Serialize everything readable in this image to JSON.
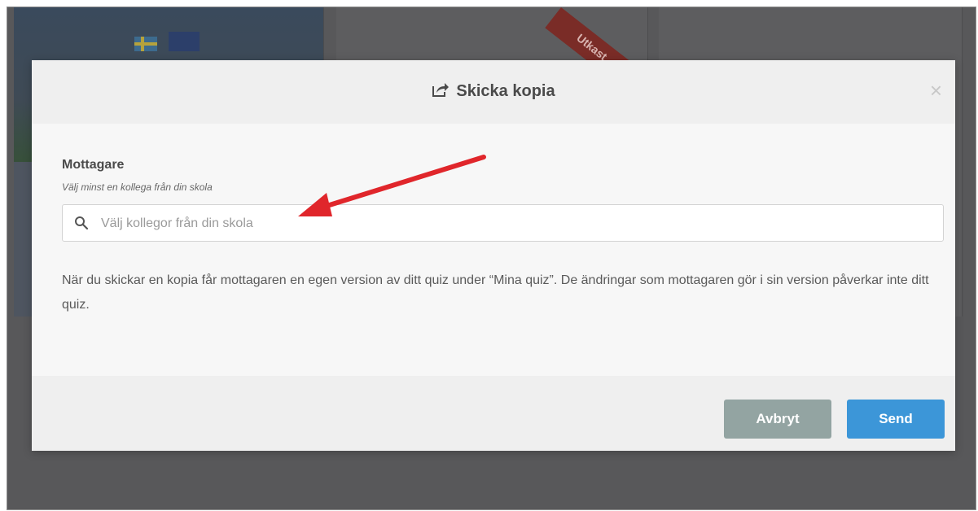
{
  "background": {
    "ribbon_text": "Utkast"
  },
  "modal": {
    "title": "Skicka kopia",
    "close_symbol": "×",
    "recipient_label": "Mottagare",
    "recipient_hint": "Välj minst en kollega från din skola",
    "search_placeholder": "Välj kollegor från din skola",
    "info_text": "När du skickar en kopia får mottagaren en egen version av ditt quiz under “Mina quiz”. De ändringar som mottagaren gör i sin version påverkar inte ditt quiz.",
    "cancel_label": "Avbryt",
    "send_label": "Send"
  },
  "icons": {
    "title_icon": "share-icon",
    "search_icon": "search-icon",
    "close_icon": "close-icon"
  },
  "colors": {
    "send_button": "#3c96d8",
    "cancel_button": "#93a4a2",
    "annotation_arrow": "#e0262b"
  }
}
